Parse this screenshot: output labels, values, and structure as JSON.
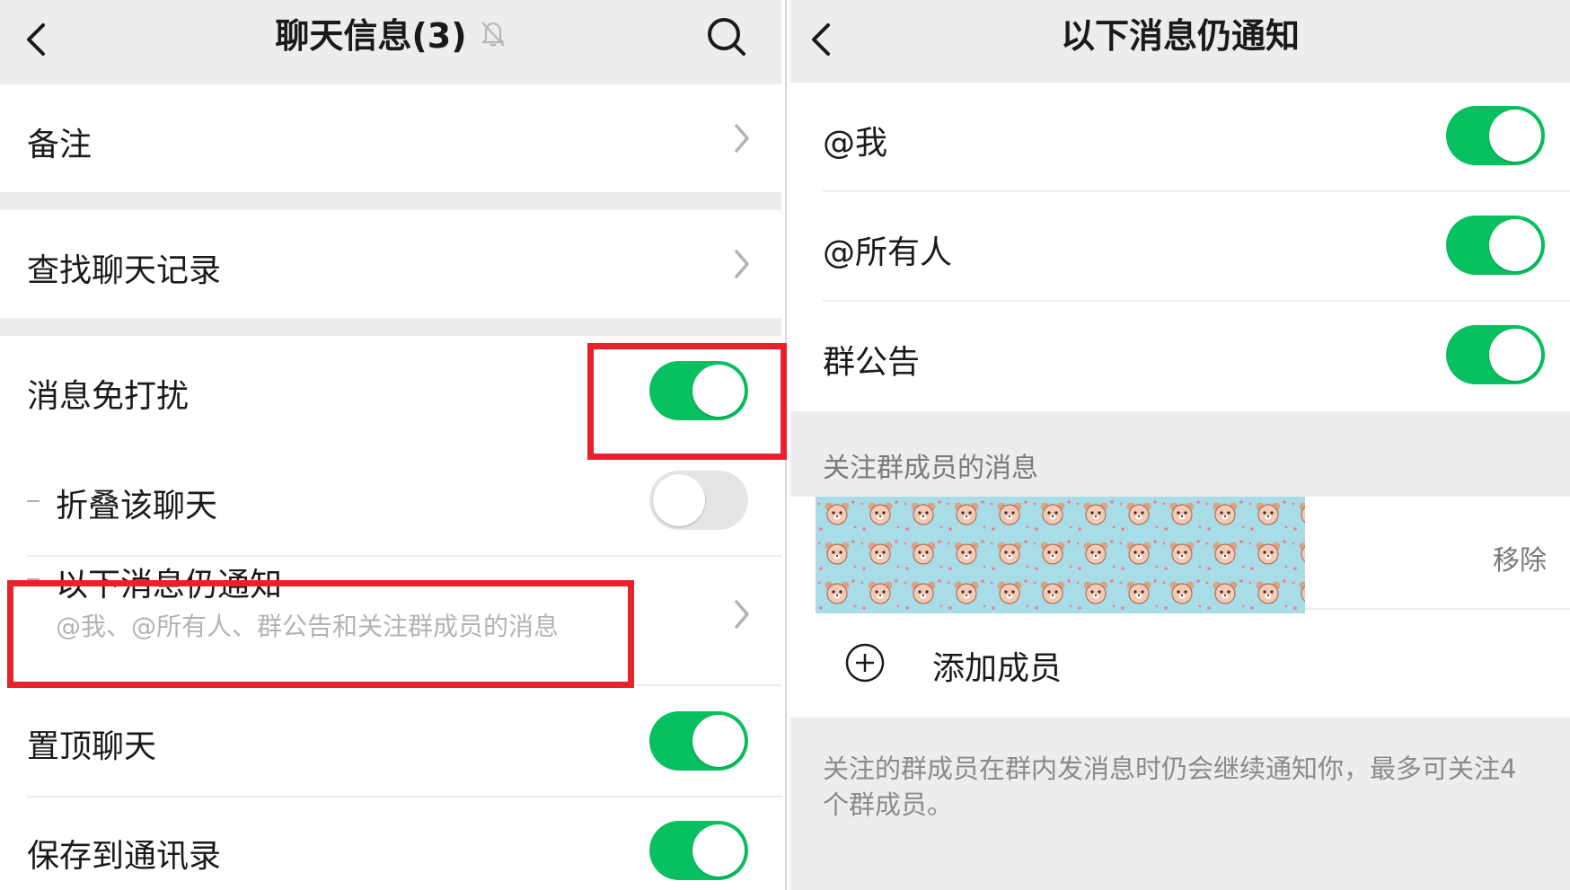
{
  "left": {
    "title": "聊天信息(3)",
    "rows": {
      "remark": "备注",
      "search_history": "查找聊天记录",
      "mute": "消息免打扰",
      "fold_chat": "折叠该聊天",
      "still_notify": "以下消息仍通知",
      "still_notify_desc": "@我、@所有人、群公告和关注群成员的消息",
      "pin_chat": "置顶聊天",
      "save_contacts": "保存到通讯录"
    },
    "toggles": {
      "mute": "on",
      "fold_chat": "off",
      "pin_chat": "on",
      "save_contacts": "on"
    }
  },
  "right": {
    "title": "以下消息仍通知",
    "rows": {
      "mention_me": "@我",
      "mention_all": "@所有人",
      "announcement": "群公告"
    },
    "toggles": {
      "mention_me": "on",
      "mention_all": "on",
      "announcement": "on"
    },
    "section_header": "关注群成员的消息",
    "remove_label": "移除",
    "add_member_label": "添加成员",
    "footnote": "关注的群成员在群内发消息时仍会继续通知你，最多可关注4个群成员。"
  },
  "colors": {
    "toggle_on": "#07c160",
    "toggle_off": "#e5e5e5",
    "highlight": "#e8212a",
    "background": "#ededed"
  }
}
